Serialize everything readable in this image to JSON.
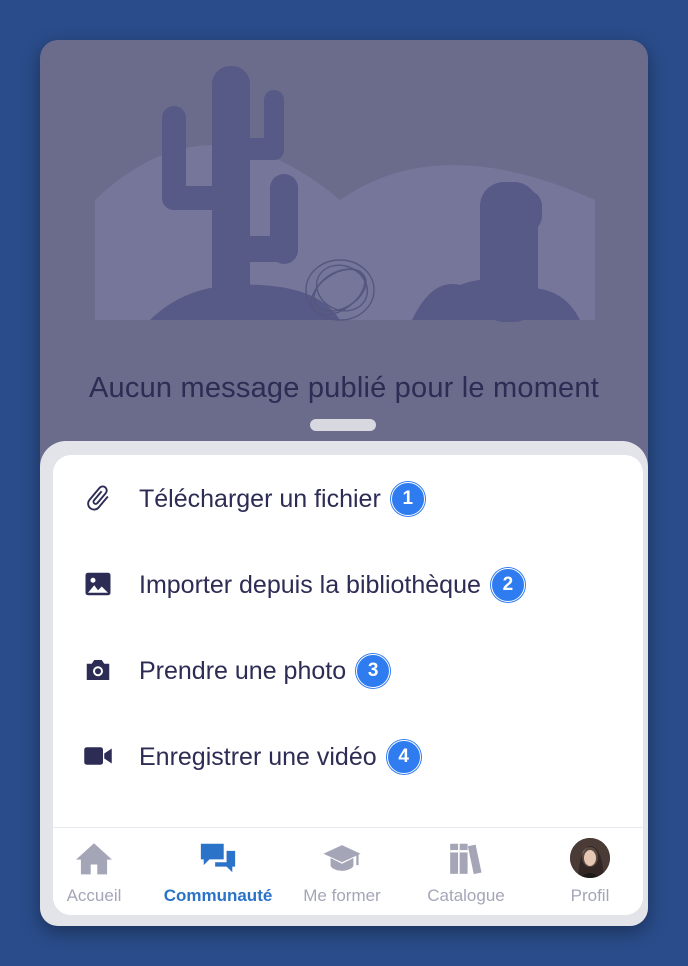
{
  "empty_state": {
    "message": "Aucun message publié pour le moment"
  },
  "sheet": {
    "items": [
      {
        "label": "Télécharger un fichier",
        "icon": "paperclip-icon",
        "badge": "1"
      },
      {
        "label": "Importer depuis la bibliothèque",
        "icon": "image-icon",
        "badge": "2"
      },
      {
        "label": "Prendre une photo",
        "icon": "camera-icon",
        "badge": "3"
      },
      {
        "label": "Enregistrer une vidéo",
        "icon": "video-camera-icon",
        "badge": "4"
      }
    ]
  },
  "tabbar": {
    "tabs": [
      {
        "label": "Accueil",
        "icon": "home-icon",
        "active": false
      },
      {
        "label": "Communauté",
        "icon": "chat-bubbles-icon",
        "active": true
      },
      {
        "label": "Me former",
        "icon": "graduation-cap-icon",
        "active": false
      },
      {
        "label": "Catalogue",
        "icon": "books-icon",
        "active": false
      },
      {
        "label": "Profil",
        "icon": "avatar",
        "active": false
      }
    ]
  },
  "colors": {
    "background": "#2a4c8a",
    "overlay": "#6b6b8c",
    "text_dark": "#2c2c54",
    "badge": "#2f7bf0",
    "tab_active": "#2b73c8",
    "tab_inactive": "#a4a6b8"
  }
}
